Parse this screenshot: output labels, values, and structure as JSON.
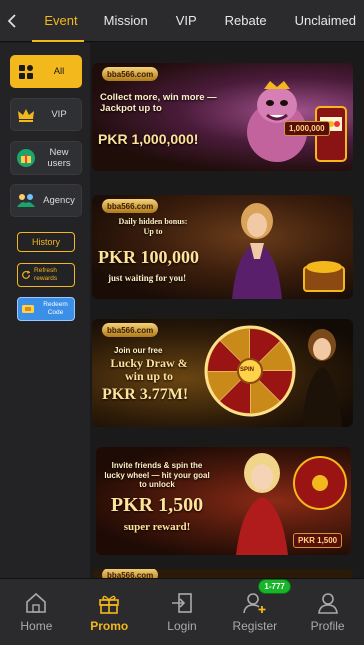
{
  "tabs": [
    "Event",
    "Mission",
    "VIP",
    "Rebate",
    "Unclaimed"
  ],
  "sidebar": {
    "categories": [
      {
        "label": "All",
        "icon": "grid-icon"
      },
      {
        "label": "VIP",
        "icon": "crown-icon"
      },
      {
        "label": "New users",
        "icon": "gift-icon"
      },
      {
        "label": "Agency",
        "icon": "handshake-icon"
      }
    ],
    "history": "History",
    "refresh": "Refresh rewards",
    "redeem": "Redeem Code"
  },
  "banners": [
    {
      "logo": "bba566.com",
      "line1": "Collect more, win more —",
      "line2": "Jackpot up to",
      "amount": "PKR 1,000,000!",
      "chip": "1,000,000"
    },
    {
      "logo": "bba566.com",
      "line1": "Daily hidden bonus:",
      "line2": "Up to",
      "amount": "PKR 100,000",
      "line3": "just waiting for you!"
    },
    {
      "logo": "bba566.com",
      "line1": "Join our free",
      "line2": "Lucky Draw & win up to",
      "amount": "PKR 3.77M!",
      "wheel": "SPIN"
    },
    {
      "logo": "bba566.com",
      "line1": "Invite friends & spin the lucky wheel — hit your goal to unlock",
      "amount": "PKR 1,500",
      "line2": "super reward!",
      "chip": "PKR 1,500"
    },
    {
      "logo": "bba566.com"
    }
  ],
  "nav": {
    "items": [
      {
        "label": "Home",
        "icon": "home-icon"
      },
      {
        "label": "Promo",
        "icon": "gift-icon"
      },
      {
        "label": "Login",
        "icon": "login-icon"
      },
      {
        "label": "Register",
        "icon": "register-icon"
      },
      {
        "label": "Profile",
        "icon": "profile-icon"
      }
    ],
    "register_badge": "1-777"
  },
  "colors": {
    "accent": "#f3b81c",
    "panel": "#2b2b2d",
    "background": "#1a1a1a"
  }
}
